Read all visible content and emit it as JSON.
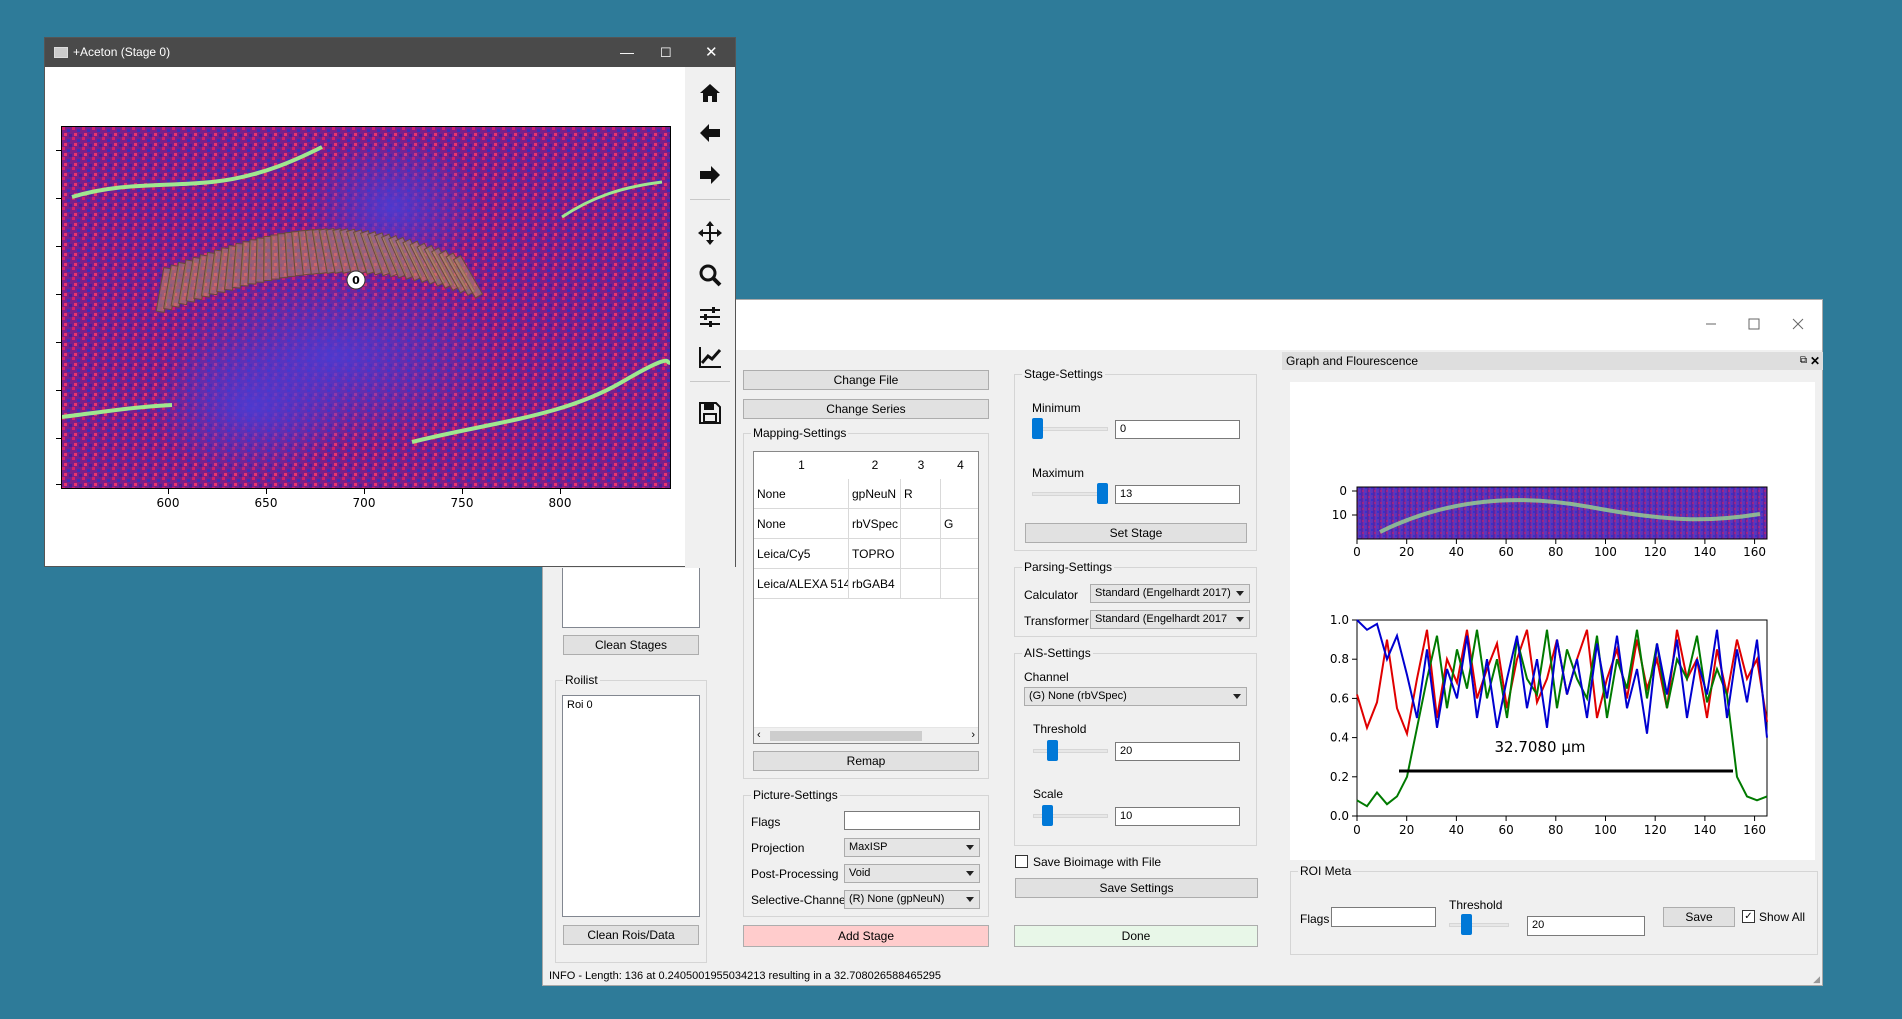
{
  "aceton_window": {
    "title": "+Aceton (Stage 0)",
    "roi_marker": "0",
    "x_ticks": [
      "600",
      "650",
      "700",
      "750",
      "800"
    ],
    "toolbar_icons": [
      "home-icon",
      "back-arrow-icon",
      "forward-arrow-icon",
      "pan-icon",
      "zoom-icon",
      "configure-subplots-icon",
      "edit-axis-icon",
      "save-icon"
    ]
  },
  "main_window": {
    "buttons": {
      "change_file": "Change File",
      "change_series": "Change Series",
      "remap": "Remap",
      "add_stage": "Add Stage",
      "set_stage": "Set Stage",
      "save_settings": "Save Settings",
      "done": "Done",
      "clean_stages": "Clean Stages",
      "clean_rois": "Clean Rois/Data"
    },
    "mapping": {
      "title": "Mapping-Settings",
      "headers": [
        "1",
        "2",
        "3",
        "4"
      ],
      "rows": [
        [
          "None",
          "gpNeuN",
          "R",
          ""
        ],
        [
          "None",
          "rbVSpec",
          "",
          "G"
        ],
        [
          "Leica/Cy5",
          "TOPRO",
          "",
          ""
        ],
        [
          "Leica/ALEXA 514",
          "rbGAB4",
          "",
          ""
        ]
      ]
    },
    "picture": {
      "title": "Picture-Settings",
      "flags_label": "Flags",
      "flags_value": "",
      "projection_label": "Projection",
      "projection_value": "MaxISP",
      "post_label": "Post-Processing",
      "post_value": "Void",
      "selective_label": "Selective-Channel",
      "selective_value": "(R) None (gpNeuN)"
    },
    "roilist": {
      "title": "Roilist",
      "items": [
        "Roi 0"
      ]
    },
    "stage": {
      "title": "Stage-Settings",
      "min_label": "Minimum",
      "min_value": "0",
      "max_label": "Maximum",
      "max_value": "13"
    },
    "parsing": {
      "title": "Parsing-Settings",
      "calc_label": "Calculator",
      "calc_value": "Standard (Engelhardt 2017)",
      "trans_label": "Transformer",
      "trans_value": "Standard (Engelhardt 2017"
    },
    "ais": {
      "title": "AIS-Settings",
      "channel_label": "Channel",
      "channel_value": "(G) None (rbVSpec)",
      "threshold_label": "Threshold",
      "threshold_value": "20",
      "scale_label": "Scale",
      "scale_value": "10"
    },
    "save_bioimage_label": "Save Bioimage with File",
    "graph_dock": {
      "title": "Graph and Flourescence",
      "measurement": "32.7080 µm",
      "strip_yticks": [
        "0",
        "10"
      ],
      "xticks": [
        "0",
        "20",
        "40",
        "60",
        "80",
        "100",
        "120",
        "140",
        "160"
      ],
      "yticks": [
        "0.0",
        "0.2",
        "0.4",
        "0.6",
        "0.8",
        "1.0"
      ]
    },
    "roi_meta": {
      "title": "ROI Meta",
      "flags_label": "Flags",
      "threshold_label": "Threshold",
      "threshold_value": "20",
      "save_label": "Save",
      "show_all_label": "Show All"
    },
    "status": "INFO - Length: 136 at 0.2405001955034213 resulting in a 32.708026588465295"
  },
  "colors": {
    "desktop": "#2e7b99",
    "accent": "#0078d7",
    "add_stage_bg": "#ffcccc",
    "done_bg": "#e8f7e8",
    "series_red": "#e00000",
    "series_green": "#007a00",
    "series_blue": "#0000d0"
  },
  "chart_data": {
    "type": "line",
    "title": "",
    "xlabel": "",
    "ylabel": "",
    "xlim": [
      0,
      165
    ],
    "ylim": [
      0,
      1.0
    ],
    "grid": false,
    "annotation": "32.7080 µm",
    "series": [
      {
        "values": [
          0.62,
          0.45,
          0.58,
          0.9,
          0.55,
          0.42,
          0.7,
          0.95,
          0.5,
          0.8,
          0.68,
          0.95,
          0.6,
          0.75,
          0.88,
          0.55,
          0.8,
          0.95,
          0.58,
          0.7,
          0.9,
          0.62,
          0.8,
          0.95,
          0.5,
          0.7,
          0.85,
          0.6,
          0.9,
          0.65,
          0.8,
          0.55,
          0.95,
          0.7,
          0.8,
          0.5,
          0.85,
          0.62,
          0.9,
          0.7,
          0.8,
          0.48
        ]
      },
      {
        "values": [
          0.08,
          0.05,
          0.12,
          0.06,
          0.1,
          0.2,
          0.45,
          0.7,
          0.92,
          0.55,
          0.85,
          0.65,
          0.95,
          0.6,
          0.8,
          0.5,
          0.9,
          0.7,
          0.62,
          0.95,
          0.55,
          0.85,
          0.7,
          0.6,
          0.92,
          0.5,
          0.8,
          0.65,
          0.95,
          0.6,
          0.88,
          0.55,
          0.8,
          0.7,
          0.92,
          0.58,
          0.75,
          0.62,
          0.2,
          0.1,
          0.08,
          0.1
        ]
      },
      {
        "values": [
          1.0,
          0.95,
          0.98,
          0.8,
          0.92,
          0.72,
          0.5,
          0.85,
          0.45,
          0.75,
          0.6,
          0.92,
          0.5,
          0.8,
          0.45,
          0.7,
          0.92,
          0.55,
          0.8,
          0.45,
          0.9,
          0.62,
          0.8,
          0.5,
          0.88,
          0.6,
          0.92,
          0.55,
          0.75,
          0.42,
          0.88,
          0.62,
          0.9,
          0.5,
          0.8,
          0.62,
          0.95,
          0.5,
          0.85,
          0.58,
          0.9,
          0.4
        ]
      }
    ]
  }
}
